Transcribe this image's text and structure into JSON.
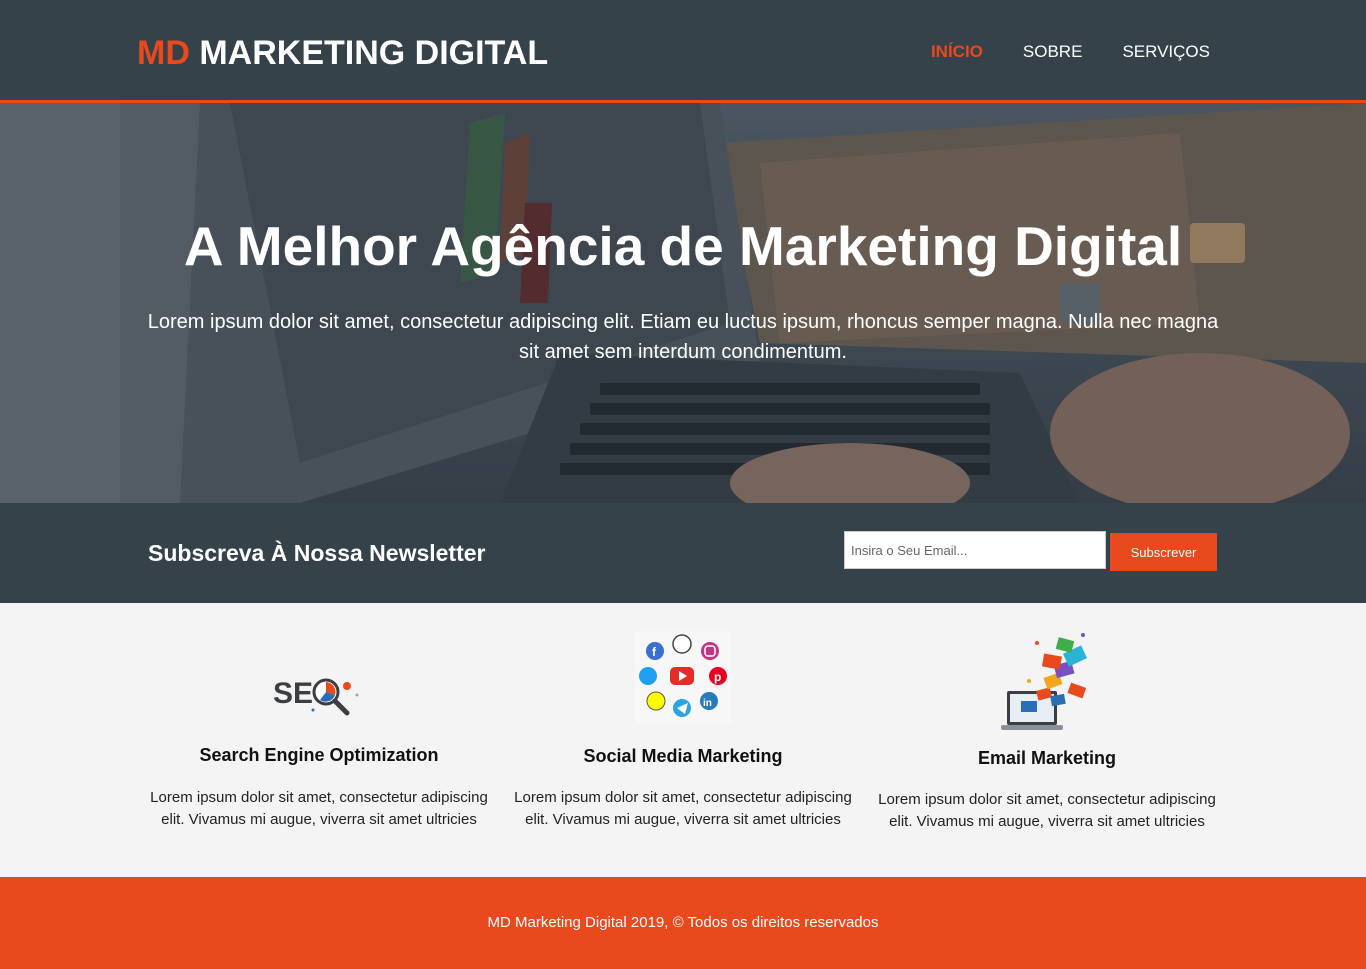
{
  "header": {
    "logo_highlight": "MD",
    "logo_rest": "MARKETING DIGITAL",
    "nav": [
      {
        "label": "INÍCIO",
        "active": true
      },
      {
        "label": "SOBRE",
        "active": false
      },
      {
        "label": "SERVIÇOS",
        "active": false
      }
    ]
  },
  "hero": {
    "title": "A Melhor Agência de Marketing Digital",
    "text": "Lorem ipsum dolor sit amet, consectetur adipiscing elit. Etiam eu luctus ipsum, rhoncus semper magna. Nulla nec magna sit amet sem interdum condimentum."
  },
  "newsletter": {
    "title": "Subscreva À Nossa Newsletter",
    "email_placeholder": "Insira o Seu Email...",
    "button_label": "Subscrever"
  },
  "services": [
    {
      "title": "Search Engine Optimization",
      "text": "Lorem ipsum dolor sit amet, consectetur adipiscing elit. Vivamus mi augue, viverra sit amet ultricies",
      "icon": "seo-icon"
    },
    {
      "title": "Social Media Marketing",
      "text": "Lorem ipsum dolor sit amet, consectetur adipiscing elit. Vivamus mi augue, viverra sit amet ultricies",
      "icon": "social-media-icon"
    },
    {
      "title": "Email Marketing",
      "text": "Lorem ipsum dolor sit amet, consectetur adipiscing elit. Vivamus mi augue, viverra sit amet ultricies",
      "icon": "email-marketing-icon"
    }
  ],
  "footer": {
    "text": "MD Marketing Digital 2019, © Todos os direitos reservados"
  },
  "colors": {
    "accent": "#e8491d",
    "dark": "#35424a",
    "light_bg": "#f4f4f4"
  }
}
